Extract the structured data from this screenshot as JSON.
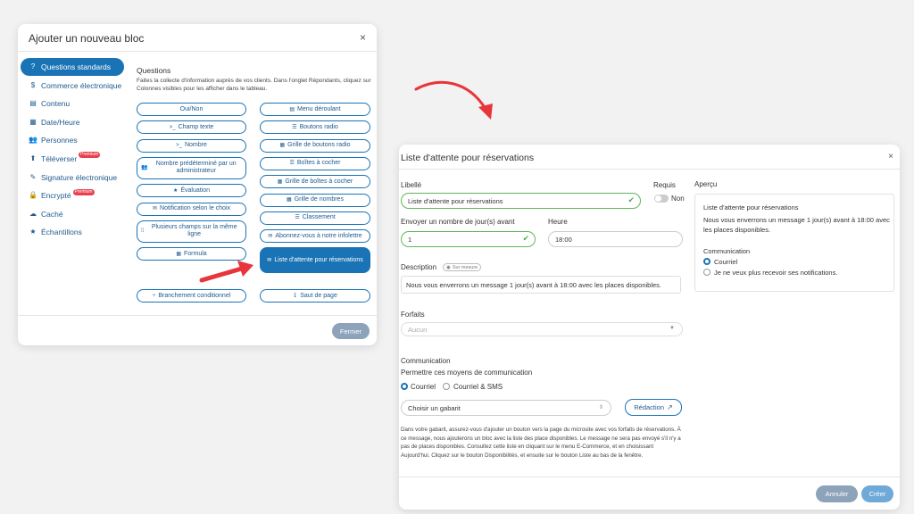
{
  "left_modal": {
    "title": "Ajouter un nouveau bloc",
    "close": "×",
    "sidebar": [
      {
        "label": "Questions standards",
        "icon": "question-icon",
        "glyph": "?",
        "active": true
      },
      {
        "label": "Commerce électronique",
        "icon": "dollar-icon",
        "glyph": "$"
      },
      {
        "label": "Contenu",
        "icon": "content-icon",
        "glyph": "▤"
      },
      {
        "label": "Date/Heure",
        "icon": "calendar-icon",
        "glyph": "▦"
      },
      {
        "label": "Personnes",
        "icon": "users-icon",
        "glyph": "👥"
      },
      {
        "label": "Téléverser",
        "icon": "upload-icon",
        "glyph": "⬆",
        "premium": "Premium"
      },
      {
        "label": "Signature électronique",
        "icon": "signature-icon",
        "glyph": "✎"
      },
      {
        "label": "Encrypté",
        "icon": "lock-icon",
        "glyph": "🔒",
        "premium": "Premium"
      },
      {
        "label": "Caché",
        "icon": "hidden-icon",
        "glyph": "☁"
      },
      {
        "label": "Échantillons",
        "icon": "star-icon",
        "glyph": "★"
      }
    ],
    "section_title": "Questions",
    "section_desc": "Faites la collecte d'information auprès de vos clients. Dans l'onglet Répondants, cliquez sur Colonnes visibles pour les afficher dans le tableau.",
    "left_buttons": [
      {
        "label": "Oui/Non",
        "glyph": ""
      },
      {
        "label": "Champ texte",
        "glyph": ">_"
      },
      {
        "label": "Nombre",
        "glyph": ">_"
      },
      {
        "label": "Nombre prédéterminé par un administrateur",
        "glyph": "👥",
        "tall": true
      },
      {
        "label": "Évaluation",
        "glyph": "★"
      },
      {
        "label": "Notification selon le choix",
        "glyph": "✉"
      },
      {
        "label": "Plusieurs champs sur la même ligne",
        "glyph": "⁞⁞",
        "tall": true
      },
      {
        "label": "Formula",
        "glyph": "▦"
      }
    ],
    "right_buttons": [
      {
        "label": "Menu déroulant",
        "glyph": "▤"
      },
      {
        "label": "Boutons radio",
        "glyph": "☰"
      },
      {
        "label": "Grille de boutons radio",
        "glyph": "▦"
      },
      {
        "label": "Boîtes à cocher",
        "glyph": "☰"
      },
      {
        "label": "Grille de boîtes à cocher",
        "glyph": "▦"
      },
      {
        "label": "Grille de nombres",
        "glyph": "▦"
      },
      {
        "label": "Classement",
        "glyph": "☰"
      },
      {
        "label": "Abonnez-vous à notre infolettre",
        "glyph": "✉"
      },
      {
        "label": "Liste d'attente pour réservations",
        "glyph": "✉",
        "selected": true
      }
    ],
    "bottom_left": {
      "label": "Branchement conditionnel",
      "glyph": "⑂"
    },
    "bottom_right": {
      "label": "Saut de page",
      "glyph": "↧"
    },
    "close_button": "Fermer"
  },
  "right_modal": {
    "title": "Liste d'attente pour réservations",
    "close": "×",
    "libelle_label": "Libellé",
    "libelle_value": "Liste d'attente pour réservations",
    "requis_label": "Requis",
    "requis_value": "Non",
    "days_label": "Envoyer un nombre de jour(s) avant",
    "days_value": "1",
    "heure_label": "Heure",
    "heure_value": "18:00",
    "description_label": "Description",
    "sur_mesure": "Sur mesure",
    "description_value": "Nous vous enverrons un message 1 jour(s) avant à 18:00 avec les places disponibles.",
    "forfaits_label": "Forfaits",
    "forfaits_value": "Aucun",
    "communication_label": "Communication",
    "permettre_label": "Permettre ces moyens de communication",
    "radio_courriel": "Courriel",
    "radio_sms": "Courriel & SMS",
    "gabarit_value": "Choisir un gabarit",
    "redaction_label": "Rédaction",
    "help_text": "Dans votre gabarit, assurez-vous d'ajouter un bouton vers la page du microsite avec vos forfaits de réservations. À ce message, nous ajouterons un bloc avec la liste des place disponibles. Le message ne sera pas envoyé s'il n'y a pas de places disponibles. Consultez cette liste en cliquant sur le menu E-Commerce, et en choisissant Aujourd'hui. Cliquez sur le bouton Disponibilités, et ensuite sur le bouton Liste au bas de la fenêtre.",
    "apercu_label": "Aperçu",
    "preview": {
      "title": "Liste d'attente pour réservations",
      "message": "Nous vous enverrons un message 1 jour(s) avant à 18:00 avec les places disponibles.",
      "comm_label": "Communication",
      "opt1": "Courriel",
      "opt2": "Je ne veux plus recevoir ses notifications."
    },
    "cancel_button": "Annuler",
    "create_button": "Créer"
  },
  "colors": {
    "primary": "#1a73b5",
    "arrow": "#e8353b",
    "success": "#5fb75a"
  }
}
